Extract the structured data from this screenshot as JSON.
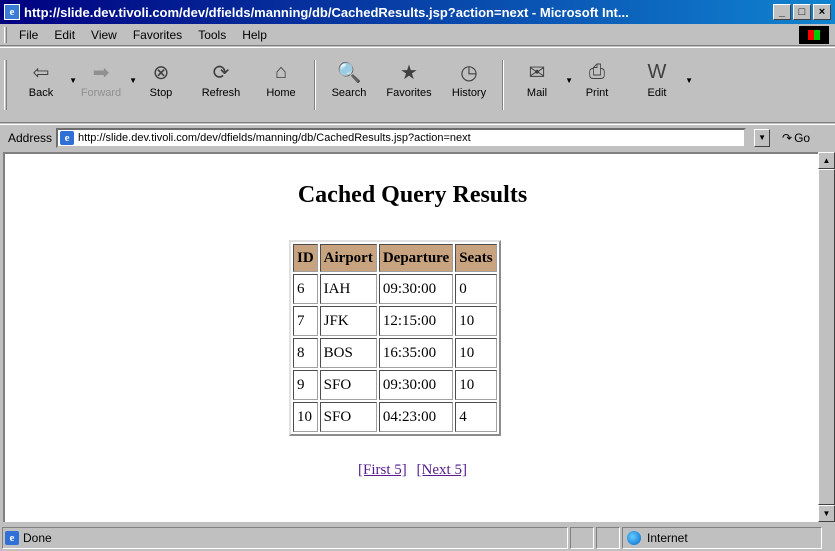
{
  "window": {
    "title": "http://slide.dev.tivoli.com/dev/dfields/manning/db/CachedResults.jsp?action=next - Microsoft Int...",
    "app_icon": "e",
    "controls": [
      "_",
      "□",
      "×"
    ]
  },
  "menu": {
    "items": [
      "File",
      "Edit",
      "View",
      "Favorites",
      "Tools",
      "Help"
    ]
  },
  "toolbar": {
    "buttons": [
      {
        "label": "Back",
        "icon": "back-arrow-icon"
      },
      {
        "label": "Forward",
        "icon": "forward-arrow-icon"
      },
      {
        "label": "Stop",
        "icon": "stop-icon"
      },
      {
        "label": "Refresh",
        "icon": "refresh-icon"
      },
      {
        "label": "Home",
        "icon": "home-icon"
      },
      {
        "label": "Search",
        "icon": "search-icon"
      },
      {
        "label": "Favorites",
        "icon": "favorites-icon"
      },
      {
        "label": "History",
        "icon": "history-icon"
      },
      {
        "label": "Mail",
        "icon": "mail-icon"
      },
      {
        "label": "Print",
        "icon": "print-icon"
      },
      {
        "label": "Edit",
        "icon": "edit-icon"
      }
    ]
  },
  "address": {
    "label": "Address",
    "url": "http://slide.dev.tivoli.com/dev/dfields/manning/db/CachedResults.jsp?action=next",
    "go_label": "Go"
  },
  "page": {
    "title": "Cached Query Results",
    "table": {
      "headers": [
        "ID",
        "Airport",
        "Departure",
        "Seats"
      ],
      "rows": [
        [
          "6",
          "IAH",
          "09:30:00",
          "0"
        ],
        [
          "7",
          "JFK",
          "12:15:00",
          "10"
        ],
        [
          "8",
          "BOS",
          "16:35:00",
          "10"
        ],
        [
          "9",
          "SFO",
          "09:30:00",
          "10"
        ],
        [
          "10",
          "SFO",
          "04:23:00",
          "4"
        ]
      ],
      "header_color": "#c8a37f"
    },
    "pager": {
      "first": "[First 5]",
      "next": "[Next 5]"
    }
  },
  "status": {
    "text": "Done",
    "zone": "Internet"
  },
  "colors": {
    "titlebar": "#000080",
    "link": "#551a8b"
  }
}
